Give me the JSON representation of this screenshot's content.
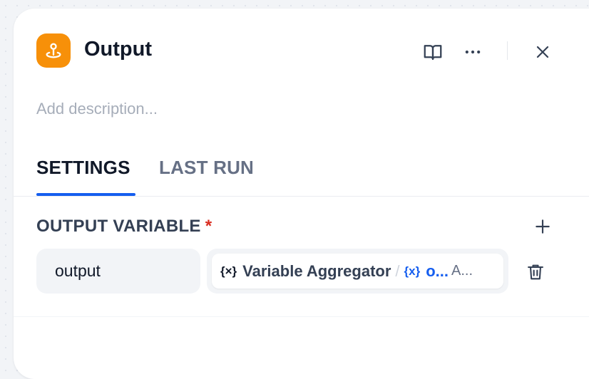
{
  "header": {
    "title": "Output",
    "icon": "output-node-icon",
    "accent": "#f79009"
  },
  "description": {
    "placeholder": "Add description..."
  },
  "tabs": [
    {
      "label": "SETTINGS",
      "active": true
    },
    {
      "label": "LAST RUN",
      "active": false
    }
  ],
  "output_variable": {
    "label": "OUTPUT VARIABLE",
    "required_mark": "*",
    "rows": [
      {
        "name": "output",
        "var_icon": "{×}",
        "node": "Variable Aggregator",
        "separator": "/",
        "var_icon_blue": "{x}",
        "variable": "o...",
        "type": "A..."
      }
    ]
  },
  "colors": {
    "primary": "#155eef",
    "required": "#d92d20",
    "text": "#101828",
    "muted": "#667085"
  }
}
